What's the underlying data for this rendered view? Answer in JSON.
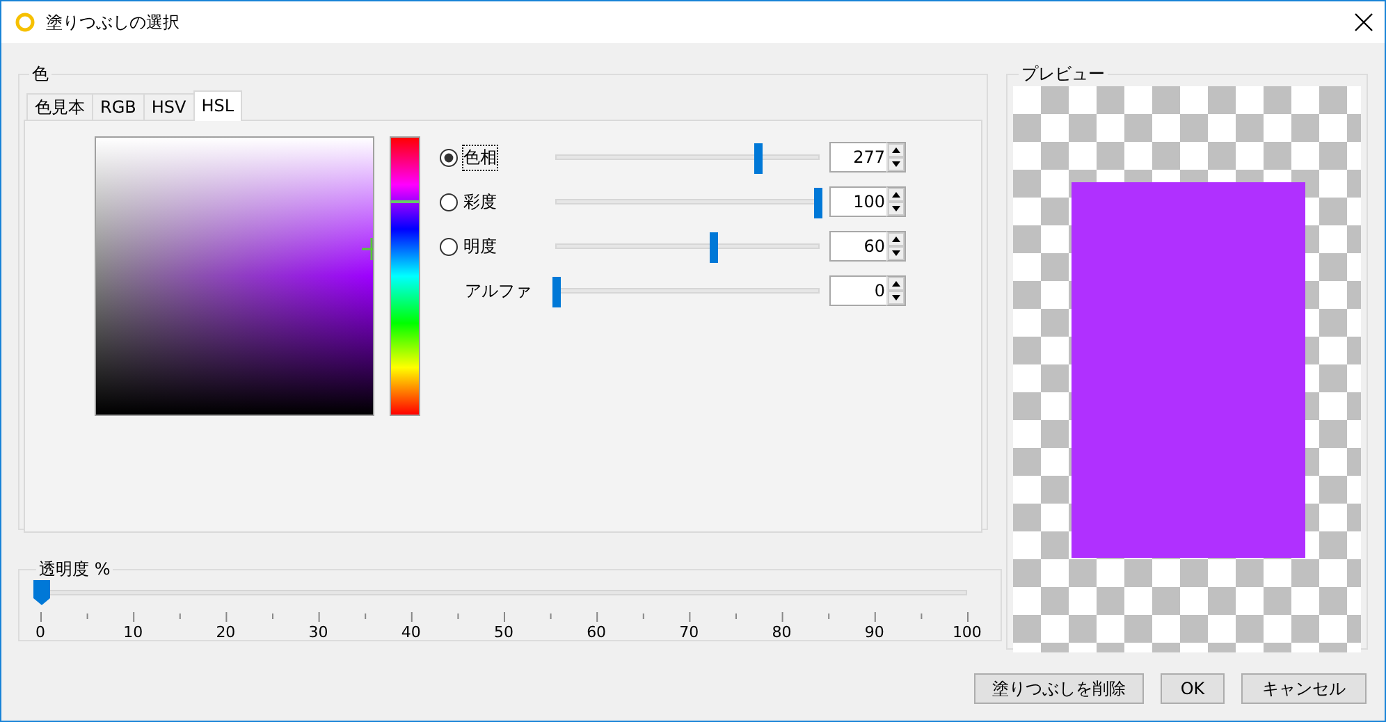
{
  "window": {
    "title": "塗りつぶしの選択"
  },
  "color_group": {
    "label": "色",
    "tabs": [
      {
        "label": "色見本",
        "selected": false
      },
      {
        "label": "RGB",
        "selected": false
      },
      {
        "label": "HSV",
        "selected": false
      },
      {
        "label": "HSL",
        "selected": true
      }
    ],
    "channels": [
      {
        "kind": "radio",
        "label": "色相",
        "selected": true,
        "level": 0.77,
        "value": "277"
      },
      {
        "kind": "radio",
        "label": "彩度",
        "selected": false,
        "level": 1.0,
        "value": "100"
      },
      {
        "kind": "radio",
        "label": "明度",
        "selected": false,
        "level": 0.6,
        "value": "60"
      },
      {
        "kind": "plain",
        "label": "アルファ",
        "level": 0,
        "value": "0"
      }
    ]
  },
  "transparency_group": {
    "label": "透明度 %",
    "level": 0,
    "tick_labels": [
      "0",
      "10",
      "20",
      "30",
      "40",
      "50",
      "60",
      "70",
      "80",
      "90",
      "100"
    ]
  },
  "preview_group": {
    "label": "プレビュー"
  },
  "buttons": [
    "塗りつぶしを削除",
    "OK",
    "キャンセル"
  ]
}
